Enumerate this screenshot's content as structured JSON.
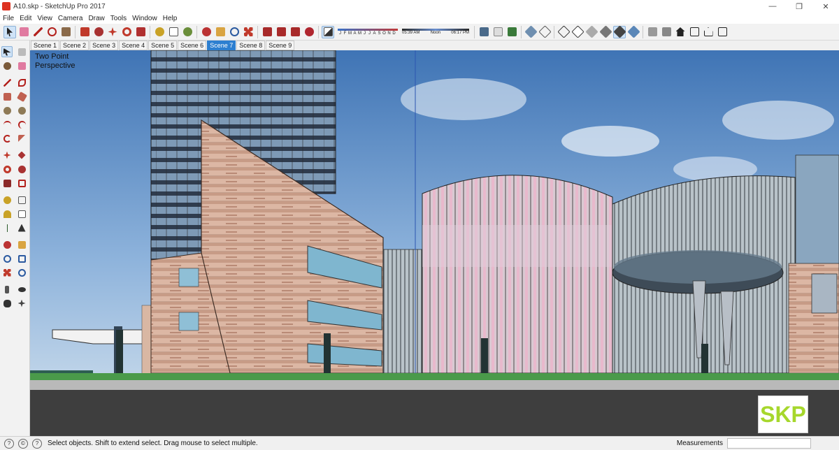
{
  "window": {
    "title": "A10.skp - SketchUp Pro 2017",
    "minimize": "—",
    "maximize": "❐",
    "close": "✕"
  },
  "menu": [
    "File",
    "Edit",
    "View",
    "Camera",
    "Draw",
    "Tools",
    "Window",
    "Help"
  ],
  "toolbar": {
    "shadow_months": [
      "J",
      "F",
      "M",
      "A",
      "M",
      "J",
      "J",
      "A",
      "S",
      "O",
      "N",
      "D"
    ],
    "time_start": "05:39 AM",
    "time_noon": "Noon",
    "time_end": "06:17 PM"
  },
  "scenes": [
    "Scene 1",
    "Scene 2",
    "Scene 3",
    "Scene 4",
    "Scene 5",
    "Scene 6",
    "Scene 7",
    "Scene 8",
    "Scene 9"
  ],
  "active_scene": "Scene 7",
  "viewport": {
    "camera_line1": "Two Point",
    "camera_line2": "Perspective",
    "watermark": "SKP"
  },
  "status": {
    "text": "Select objects. Shift to extend select. Drag mouse to select multiple.",
    "measurements_label": "Measurements",
    "measurements_value": ""
  },
  "colors": {
    "accent": "#2d7fd0",
    "watermark": "#a6d72c"
  }
}
